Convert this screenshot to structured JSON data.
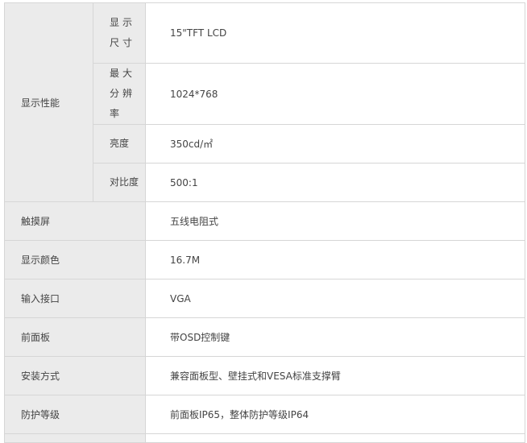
{
  "specs": {
    "display_group": {
      "label": "显示性能",
      "rows": [
        {
          "label": "显示尺寸",
          "value": "15\"TFT  LCD"
        },
        {
          "label": "最大分辨率",
          "value": "1024*768"
        },
        {
          "label": "亮度",
          "value": "350cd/㎡"
        },
        {
          "label": "对比度",
          "value": "500:1"
        }
      ]
    },
    "rows": [
      {
        "label": "触摸屏",
        "value": "五线电阻式"
      },
      {
        "label": "显示颜色",
        "value": "16.7M"
      },
      {
        "label": "输入接口",
        "value": "VGA"
      },
      {
        "label": "前面板",
        "value": "带OSD控制键"
      },
      {
        "label": "安装方式",
        "value": "兼容面板型、壁挂式和VESA标准支撑臂"
      },
      {
        "label": "防护等级",
        "value": "前面板IP65，整体防护等级IP64"
      }
    ]
  }
}
